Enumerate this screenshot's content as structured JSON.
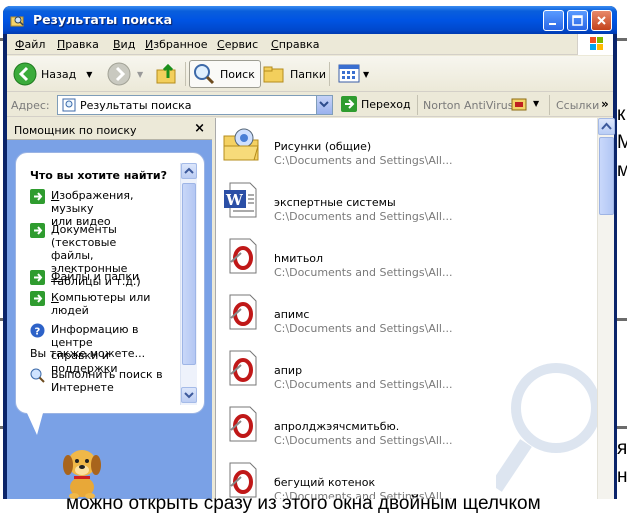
{
  "window": {
    "title": "Результаты поиска"
  },
  "menubar": {
    "items": [
      {
        "pre": "",
        "u": "Ф",
        "post": "айл"
      },
      {
        "pre": "",
        "u": "П",
        "post": "равка"
      },
      {
        "pre": "",
        "u": "В",
        "post": "ид"
      },
      {
        "pre": "",
        "u": "И",
        "post": "збранное"
      },
      {
        "pre": "",
        "u": "С",
        "post": "ервис"
      },
      {
        "pre": "",
        "u": "С",
        "post": "правка"
      }
    ]
  },
  "toolbar": {
    "back_label": "Назад",
    "search_label": "Поиск",
    "folders_label": "Папки"
  },
  "addressbar": {
    "label": "Адрес:",
    "value": "Результаты поиска",
    "go_label": "Переход",
    "antivirus_label": "Norton AntiVirus",
    "links_label": "Ссылки"
  },
  "search_pane": {
    "title": "Помощник по поиску",
    "close_glyph": "×",
    "question": "Что вы хотите найти?",
    "options": [
      {
        "u": "И",
        "rest": "зображения, музыку\nили видео"
      },
      {
        "u": "Д",
        "rest": "окументы (текстовые\nфайлы, электронные\nтаблицы и т.д.)"
      },
      {
        "u": "Ф",
        "rest": "айлы и папки"
      },
      {
        "u": "К",
        "rest": "омпьютеры или\nлюдей"
      },
      {
        "u": "",
        "rest": "Информацию в центре\nсправки и поддержки"
      }
    ],
    "also_label": "Вы также можете...",
    "web_search": "Выполнить поиск в\nИнтернете"
  },
  "results": {
    "items": [
      {
        "name": "Рисунки (общие)",
        "path": "C:\\Documents and Settings\\All...",
        "icon": "folder-icon"
      },
      {
        "name": "экспертные системы",
        "path": "C:\\Documents and Settings\\All...",
        "icon": "word-document-icon"
      },
      {
        "name": "hмитьол",
        "path": "C:\\Documents and Settings\\All...",
        "icon": "opera-file-icon"
      },
      {
        "name": "апимс",
        "path": "C:\\Documents and Settings\\All...",
        "icon": "opera-file-icon"
      },
      {
        "name": "апир",
        "path": "C:\\Documents and Settings\\All...",
        "icon": "opera-file-icon"
      },
      {
        "name": "апролджэячсмитьбю.",
        "path": "C:\\Documents and Settings\\All...",
        "icon": "opera-file-icon"
      },
      {
        "name": "бегущий котенок",
        "path": "C:\\Documents and Settings\\All...",
        "icon": "opera-file-icon"
      }
    ]
  },
  "background": {
    "bottom_line": "можно открыть сразу из этого окна двойным щелчком",
    "right_fragments": [
      "к",
      "М",
      "м",
      "я",
      "н"
    ]
  }
}
